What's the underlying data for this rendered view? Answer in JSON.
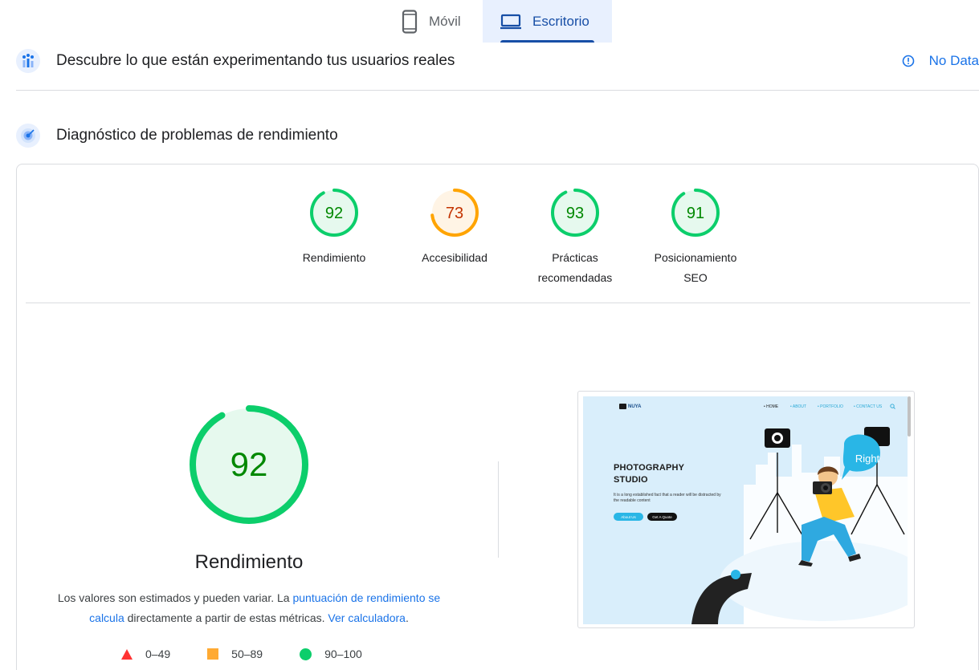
{
  "tabs": [
    {
      "label": "Móvil",
      "icon": "phone-icon",
      "selected": false
    },
    {
      "label": "Escritorio",
      "icon": "laptop-icon",
      "selected": true
    }
  ],
  "crux": {
    "title": "Descubre lo que están experimentando tus usuarios reales",
    "status": "No Data",
    "icon": "users-chart-icon"
  },
  "diagnostics": {
    "title": "Diagnóstico de problemas de rendimiento",
    "icon": "lighthouse-icon"
  },
  "scores": [
    {
      "value": "92",
      "label_lines": [
        "Rendimiento"
      ],
      "color": "#0cce6b",
      "text_color": "#008800",
      "fill": "#e6f9ee",
      "fraction": 0.92
    },
    {
      "value": "73",
      "label_lines": [
        "Accesibilidad"
      ],
      "color": "#ffa400",
      "text_color": "#c33300",
      "fill": "#fff4e5",
      "fraction": 0.73
    },
    {
      "value": "93",
      "label_lines": [
        "Prácticas",
        "recomendadas"
      ],
      "color": "#0cce6b",
      "text_color": "#008800",
      "fill": "#e6f9ee",
      "fraction": 0.93
    },
    {
      "value": "91",
      "label_lines": [
        "Posicionamiento",
        "SEO"
      ],
      "color": "#0cce6b",
      "text_color": "#008800",
      "fill": "#e6f9ee",
      "fraction": 0.91
    }
  ],
  "performance": {
    "score": "92",
    "fraction": 0.92,
    "title": "Rendimiento",
    "desc_1": "Los valores son estimados y pueden variar. La ",
    "link_1": "puntuación de rendimiento se calcula",
    "desc_2": " directamente a partir de estas métricas. ",
    "link_2": "Ver calculadora",
    "desc_3": "."
  },
  "legend": [
    {
      "range": "0–49",
      "shape": "triangle",
      "color": "#ff3333"
    },
    {
      "range": "50–89",
      "shape": "square",
      "color": "#ffaa33"
    },
    {
      "range": "90–100",
      "shape": "circle",
      "color": "#0cce6b"
    }
  ],
  "thumbnail": {
    "logo": "NUYA",
    "nav": [
      "• HOME",
      "• ABOUT",
      "• PORTFOLIO",
      "• CONTACT US"
    ],
    "heading_1": "PHOTOGRAPHY",
    "heading_2": "STUDIO",
    "text": "It is a long established fact that a reader will be distracted by the readable content",
    "btn_1": "About Us",
    "btn_2": "Get A Quote",
    "bubble": "Right"
  }
}
